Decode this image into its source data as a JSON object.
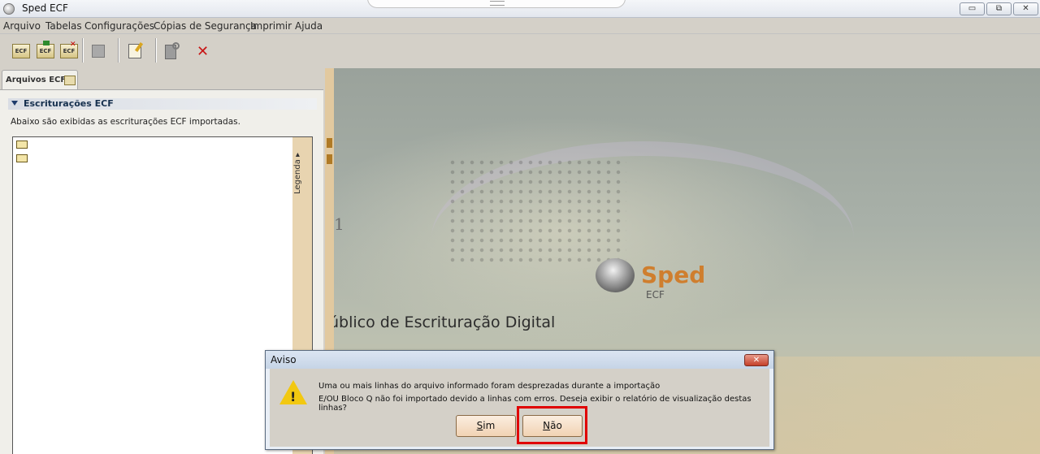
{
  "window": {
    "title": "Sped ECF",
    "controls": {
      "minimize": "▭",
      "maximize": "⧉",
      "close": "✕"
    }
  },
  "menubar": {
    "items": [
      "Arquivo",
      "Tabelas",
      "Configurações",
      "Cópias de Segurança",
      "Imprimir",
      "Ajuda"
    ]
  },
  "toolbar": {
    "ecf_label": "ECF",
    "icons": [
      "ecf-new-icon",
      "ecf-import-icon",
      "ecf-delete-icon",
      "print-icon",
      "edit-icon",
      "search-server-icon",
      "close-x-icon"
    ]
  },
  "left_panel": {
    "tab_label": "Arquivos ECF",
    "section_title": "Escriturações ECF",
    "section_description": "Abaixo são exibidas as escriturações ECF importadas.",
    "legend_label": "Legenda",
    "tree_items": 2
  },
  "background": {
    "numeral": "1",
    "brand": "Sped",
    "brand_sub": "ECF",
    "tagline": "úblico de Escrituração Digital",
    "brand_color": "#cf7e2e"
  },
  "dialog": {
    "title": "Aviso",
    "close_label": "✕",
    "message_line1": "Uma ou mais linhas do arquivo informado foram desprezadas durante a importação",
    "message_line2": "E/OU Bloco Q não foi importado devido a linhas com erros. Deseja exibir o relatório de visualização destas linhas?",
    "warning_mark": "!",
    "yes_label_first": "S",
    "yes_label_rest": "im",
    "no_label_first": "N",
    "no_label_rest": "ão",
    "highlight_color": "#e00000"
  }
}
